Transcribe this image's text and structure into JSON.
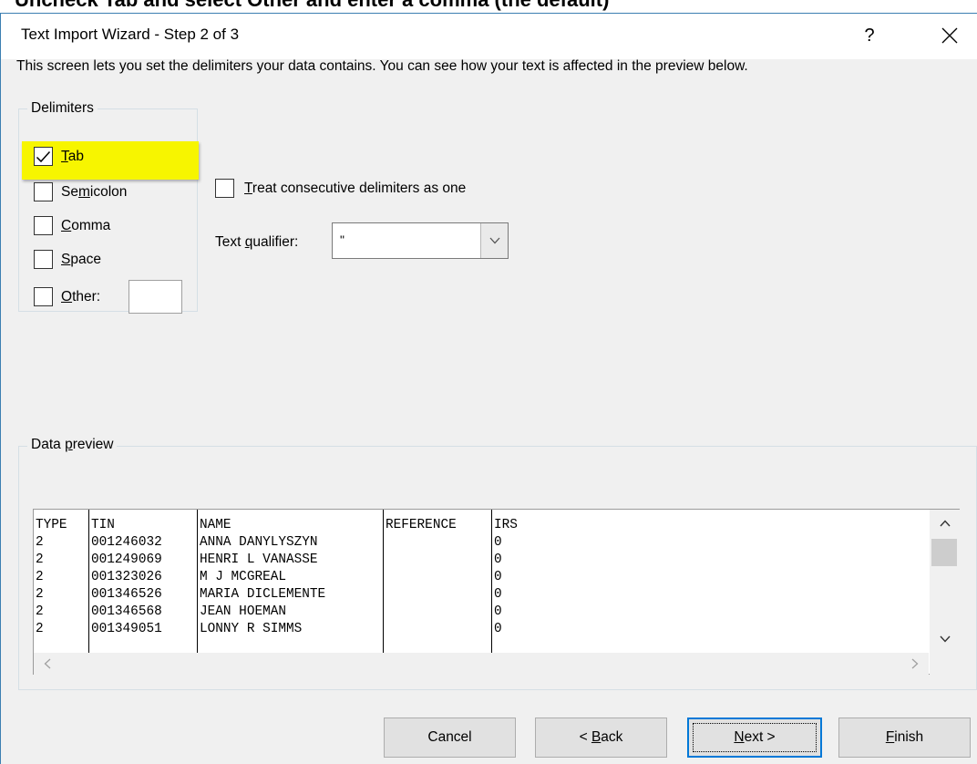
{
  "background_caption": "Uncheck Tab and select Other and enter a comma (the default)",
  "dialog": {
    "title": "Text Import Wizard - Step 2 of 3",
    "help_glyph": "?",
    "description": "This screen lets you set the delimiters your data contains.  You can see how your text is affected in the preview below.",
    "accent_color": "#0078d7",
    "highlight_color": "#f7f500"
  },
  "delimiters": {
    "legend": "Delimiters",
    "tab": {
      "checked": true,
      "hotkey": "T",
      "rest": "ab"
    },
    "semicolon": {
      "checked": false,
      "pre": "Se",
      "hotkey": "m",
      "rest": "icolon"
    },
    "comma": {
      "checked": false,
      "hotkey": "C",
      "rest": "omma"
    },
    "space": {
      "checked": false,
      "hotkey": "S",
      "rest": "pace"
    },
    "other": {
      "checked": false,
      "hotkey": "O",
      "rest": "ther:",
      "value": ""
    }
  },
  "consecutive": {
    "checked": false,
    "hotkey": "T",
    "rest": "reat consecutive delimiters as one"
  },
  "qualifier": {
    "pre": "Text ",
    "hotkey": "q",
    "rest": "ualifier:",
    "value": "\""
  },
  "preview": {
    "legend_pre": "Data ",
    "legend_hotkey": "p",
    "legend_rest": "review",
    "columns": [
      {
        "cells": [
          "TYPE",
          "2",
          "2",
          "2",
          "2",
          "2",
          "2"
        ]
      },
      {
        "cells": [
          "TIN",
          "001246032",
          "001249069",
          "001323026",
          "001346526",
          "001346568",
          "001349051"
        ]
      },
      {
        "cells": [
          "NAME",
          "ANNA DANYLYSZYN",
          "HENRI L VANASSE",
          "M J MCGREAL",
          "MARIA DICLEMENTE",
          "JEAN HOEMAN",
          "LONNY R SIMMS"
        ]
      },
      {
        "cells": [
          "REFERENCE",
          "",
          "",
          "",
          "",
          "",
          ""
        ]
      },
      {
        "cells": [
          "IRS",
          "0",
          "0",
          "0",
          "0",
          "0",
          "0"
        ]
      }
    ]
  },
  "buttons": {
    "cancel": "Cancel",
    "back_pre": "< ",
    "back_hotkey": "B",
    "back_rest": "ack",
    "next_hotkey": "N",
    "next_rest": "ext >",
    "finish_hotkey": "F",
    "finish_rest": "inish"
  },
  "icons": {
    "close": "close-icon",
    "help": "help-icon",
    "dropdown": "chevron-down-icon",
    "check": "check-icon",
    "scroll_up": "chevron-up-icon",
    "scroll_down": "chevron-down-icon",
    "scroll_left": "chevron-left-icon",
    "scroll_right": "chevron-right-icon"
  }
}
